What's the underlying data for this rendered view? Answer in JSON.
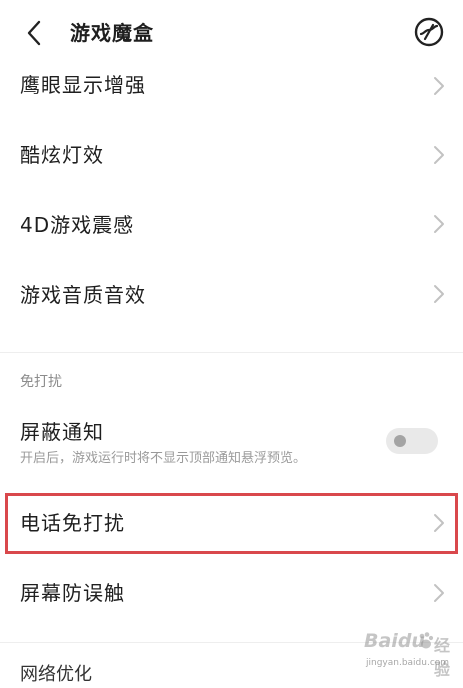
{
  "header": {
    "title": "游戏魔盒",
    "back_icon": "chevron-left-icon",
    "settings_icon": "circle-slash-icon"
  },
  "items": [
    {
      "label": "鹰眼显示增强"
    },
    {
      "label": "酷炫灯效"
    },
    {
      "label": "4D游戏震感"
    },
    {
      "label": "游戏音质音效"
    }
  ],
  "section": {
    "title": "免打扰"
  },
  "block_notification": {
    "label": "屏蔽通知",
    "description": "开启后，游戏运行时将不显示顶部通知悬浮预览。",
    "enabled": false
  },
  "call_dnd": {
    "label": "电话免打扰"
  },
  "screen_protect": {
    "label": "屏幕防误触"
  },
  "next_section": {
    "title": "网络优化"
  },
  "watermark": {
    "brand": "Baidu",
    "suffix": "经验",
    "url": "jingyan.baidu.com"
  },
  "colors": {
    "highlight": "#d9484c",
    "toggle_off": "#e9e9e9",
    "chevron": "#c2c2c2"
  }
}
